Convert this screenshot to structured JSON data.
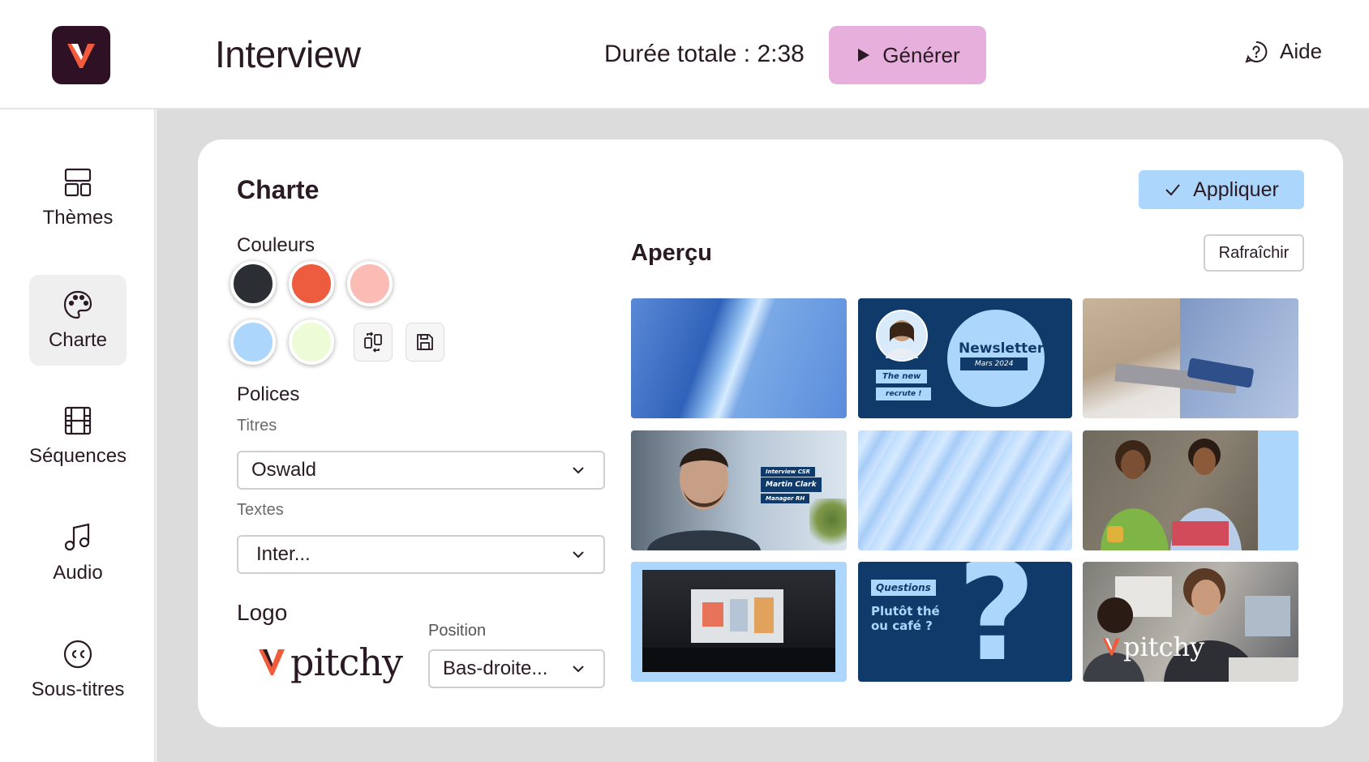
{
  "header": {
    "title": "Interview",
    "duration": "Durée totale : 2:38",
    "generate_label": "Générer",
    "help_label": "Aide",
    "brand_color": "#2e1124",
    "accent_color": "#e6afdc"
  },
  "sidebar": {
    "items": [
      {
        "label": "Thèmes",
        "icon": "layout-icon"
      },
      {
        "label": "Charte",
        "icon": "palette-icon",
        "active": true
      },
      {
        "label": "Séquences",
        "icon": "film-icon"
      },
      {
        "label": "Audio",
        "icon": "music-icon"
      },
      {
        "label": "Sous-titres",
        "icon": "cc-icon"
      }
    ]
  },
  "charte": {
    "title": "Charte",
    "apply_label": "Appliquer",
    "colors_label": "Couleurs",
    "colors": [
      "#2b2f33",
      "#ee5c3f",
      "#fcbcb6",
      "#acd6fb",
      "#edfbd6"
    ],
    "fonts_label": "Polices",
    "titles_label": "Titres",
    "titles_font": "Oswald",
    "texts_label": "Textes",
    "texts_font": "Inter...",
    "logo_label": "Logo",
    "logo_text": "pitchy",
    "position_label": "Position",
    "position_value": "Bas-droite..."
  },
  "preview": {
    "title": "Aperçu",
    "refresh_label": "Rafraîchir",
    "thumbs": {
      "newsletter_title": "Newsletter",
      "newsletter_date": "Mars 2024",
      "newsletter_tag1": "The new",
      "newsletter_tag2": "recrute !",
      "interview_tag": "Interview CSR",
      "interview_name": "Martin Clark",
      "interview_role": "Manager RH",
      "questions_tag": "Questions",
      "questions_line1": "Plutôt thé",
      "questions_line2": "ou café ?",
      "questions_mark": "?",
      "logo_overlay": "pitchy"
    }
  }
}
